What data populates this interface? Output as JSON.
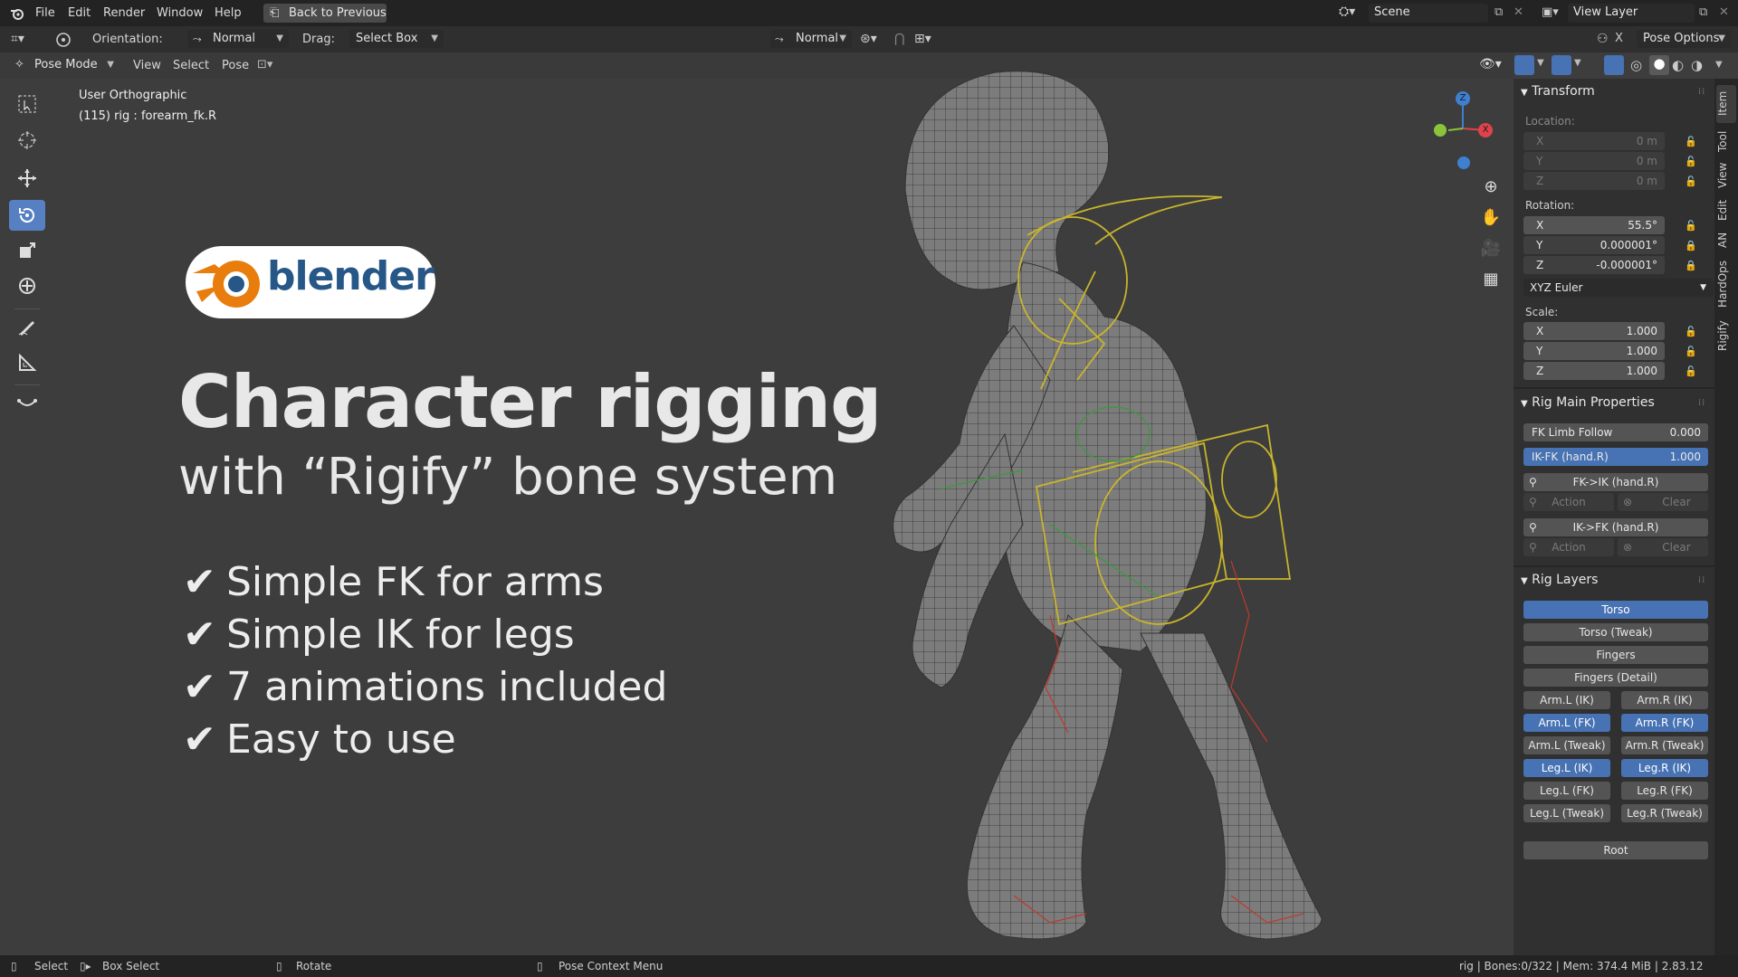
{
  "menu": {
    "items": [
      "File",
      "Edit",
      "Render",
      "Window",
      "Help"
    ],
    "back_button": "Back to Previous",
    "scene_label": "Scene",
    "view_layer_label": "View Layer"
  },
  "header": {
    "orientation_label": "Orientation:",
    "orientation_value": "Normal",
    "drag_label": "Drag:",
    "drag_value": "Select Box",
    "transform_orientation": "Normal",
    "pose_options": "Pose Options",
    "mode": "Pose Mode",
    "menus": [
      "View",
      "Select",
      "Pose"
    ]
  },
  "viewport": {
    "view_name": "User Orthographic",
    "object_info": "(115) rig : forearm_fk.R",
    "gizmo_axes": {
      "x": "X",
      "y": "Y",
      "z": "Z"
    },
    "colors": {
      "x": "#e0424c",
      "y": "#8bc33a",
      "z": "#3f7fd0"
    }
  },
  "promo": {
    "logo_text": "blender",
    "title": "Character rigging",
    "subtitle": "with “Rigify” bone system",
    "bullets": [
      "Simple FK for arms",
      "Simple IK for legs",
      "7 animations included",
      "Easy to use"
    ],
    "logo_color": "#e87d0d",
    "logo_blue": "#265787"
  },
  "npanel": {
    "tabs": [
      "Item",
      "Tool",
      "View",
      "Edit",
      "AN",
      "HardOps",
      "Rigify"
    ],
    "transform": {
      "title": "Transform",
      "location_label": "Location:",
      "location": [
        {
          "axis": "X",
          "value": "0 m"
        },
        {
          "axis": "Y",
          "value": "0 m"
        },
        {
          "axis": "Z",
          "value": "0 m"
        }
      ],
      "rotation_label": "Rotation:",
      "rotation": [
        {
          "axis": "X",
          "value": "55.5°"
        },
        {
          "axis": "Y",
          "value": "0.000001°"
        },
        {
          "axis": "Z",
          "value": "-0.000001°"
        }
      ],
      "rotation_mode": "XYZ Euler",
      "scale_label": "Scale:",
      "scale": [
        {
          "axis": "X",
          "value": "1.000"
        },
        {
          "axis": "Y",
          "value": "1.000"
        },
        {
          "axis": "Z",
          "value": "1.000"
        }
      ]
    },
    "rig_main": {
      "title": "Rig Main Properties",
      "fk_limb_follow_label": "FK Limb Follow",
      "fk_limb_follow_value": "0.000",
      "ik_fk_label": "IK-FK (hand.R)",
      "ik_fk_value": "1.000",
      "fk_to_ik": "FK->IK (hand.R)",
      "ik_to_fk": "IK->FK (hand.R)",
      "action": "Action",
      "clear": "Clear"
    },
    "rig_layers": {
      "title": "Rig Layers",
      "full": [
        {
          "label": "Torso",
          "on": true
        },
        {
          "label": "Torso (Tweak)",
          "on": false
        },
        {
          "label": "Fingers",
          "on": false
        },
        {
          "label": "Fingers (Detail)",
          "on": false
        }
      ],
      "pairs": [
        [
          {
            "label": "Arm.L (IK)",
            "on": false
          },
          {
            "label": "Arm.R (IK)",
            "on": false
          }
        ],
        [
          {
            "label": "Arm.L (FK)",
            "on": true
          },
          {
            "label": "Arm.R (FK)",
            "on": true
          }
        ],
        [
          {
            "label": "Arm.L (Tweak)",
            "on": false
          },
          {
            "label": "Arm.R (Tweak)",
            "on": false
          }
        ],
        [
          {
            "label": "Leg.L (IK)",
            "on": true
          },
          {
            "label": "Leg.R (IK)",
            "on": true
          }
        ],
        [
          {
            "label": "Leg.L (FK)",
            "on": false
          },
          {
            "label": "Leg.R (FK)",
            "on": false
          }
        ],
        [
          {
            "label": "Leg.L (Tweak)",
            "on": false
          },
          {
            "label": "Leg.R (Tweak)",
            "on": false
          }
        ]
      ],
      "root": "Root"
    }
  },
  "status": {
    "select": "Select",
    "box_select": "Box Select",
    "rotate": "Rotate",
    "context_menu": "Pose Context Menu",
    "info": "rig | Bones:0/322 | Mem: 374.4 MiB | 2.83.12"
  }
}
